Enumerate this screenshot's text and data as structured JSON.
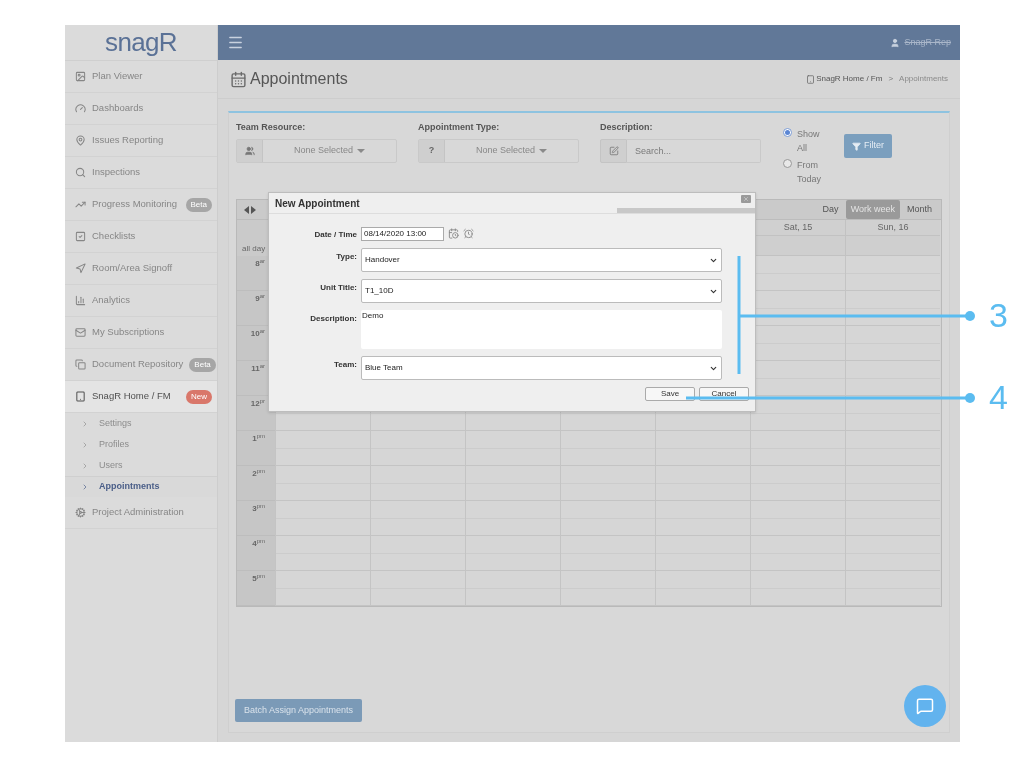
{
  "app": {
    "logo": "snagR",
    "user": "SnagR Rep"
  },
  "sidebar": {
    "items": [
      {
        "label": "Plan Viewer",
        "selected": false
      },
      {
        "label": "Dashboards",
        "selected": false
      },
      {
        "label": "Issues Reporting",
        "selected": false
      },
      {
        "label": "Inspections",
        "selected": false
      },
      {
        "label": "Progress Monitoring",
        "badge": "Beta",
        "color": "#a6a6a6",
        "selected": false
      },
      {
        "label": "Checklists",
        "selected": false
      },
      {
        "label": "Room/Area Signoff",
        "selected": false
      },
      {
        "label": "Analytics",
        "selected": false
      },
      {
        "label": "My Subscriptions",
        "selected": false
      },
      {
        "label": "Document Repository",
        "badge": "Beta",
        "color": "#a6a6a6",
        "selected": false
      },
      {
        "label": "SnagR Home / FM",
        "badge": "New",
        "color": "#d9776a",
        "selected": true,
        "children": [
          {
            "label": "Settings",
            "selected": false
          },
          {
            "label": "Profiles",
            "selected": false
          },
          {
            "label": "Users",
            "selected": false
          },
          {
            "label": "Appointments",
            "selected": true
          }
        ]
      },
      {
        "label": "Project Administration",
        "selected": false
      }
    ]
  },
  "page": {
    "title": "Appointments",
    "breadcrumb": [
      "SnagR Home / Fm",
      "Appointments"
    ],
    "breadcrumb_separator": ">"
  },
  "filters": {
    "team_resource": {
      "label": "Team Resource:",
      "value": "None Selected"
    },
    "appointment_type": {
      "label": "Appointment Type:",
      "addon": "?",
      "value": "None Selected"
    },
    "description": {
      "label": "Description:",
      "placeholder": "Search..."
    },
    "radios": [
      {
        "label": "Show All",
        "selected": true
      },
      {
        "label": "From Today",
        "selected": false
      }
    ],
    "filter_button": "Filter"
  },
  "calendar": {
    "views": [
      {
        "label": "Day",
        "selected": false
      },
      {
        "label": "Work week",
        "selected": true
      },
      {
        "label": "Month",
        "selected": false
      }
    ],
    "day_headers": [
      "Sat, 15",
      "Sun, 16"
    ],
    "all_day": "all day",
    "hours": [
      {
        "hour": "8",
        "suffix": "ar"
      },
      {
        "hour": "9",
        "suffix": "ar"
      },
      {
        "hour": "10",
        "suffix": "ar"
      },
      {
        "hour": "11",
        "suffix": "ar"
      },
      {
        "hour": "12",
        "suffix": "pr"
      },
      {
        "hour": "1",
        "suffix": "pm"
      },
      {
        "hour": "2",
        "suffix": "pm"
      },
      {
        "hour": "3",
        "suffix": "pm"
      },
      {
        "hour": "4",
        "suffix": "pm"
      },
      {
        "hour": "5",
        "suffix": "pm"
      }
    ]
  },
  "dialog": {
    "title": "New Appointment",
    "fields": [
      {
        "kind": "datetime",
        "label": "Date / Time",
        "value": "08/14/2020 13:00"
      },
      {
        "kind": "select",
        "label": "Type:",
        "value": "Handover"
      },
      {
        "kind": "select",
        "label": "Unit Title:",
        "value": "T1_10D"
      },
      {
        "kind": "textarea",
        "label": "Description:",
        "value": "Demo"
      },
      {
        "kind": "select",
        "label": "Team:",
        "value": "Blue Team"
      }
    ],
    "buttons": [
      "Save",
      "Cancel"
    ]
  },
  "batch_button": "Batch Assign Appointments",
  "callouts": [
    "3",
    "4"
  ]
}
